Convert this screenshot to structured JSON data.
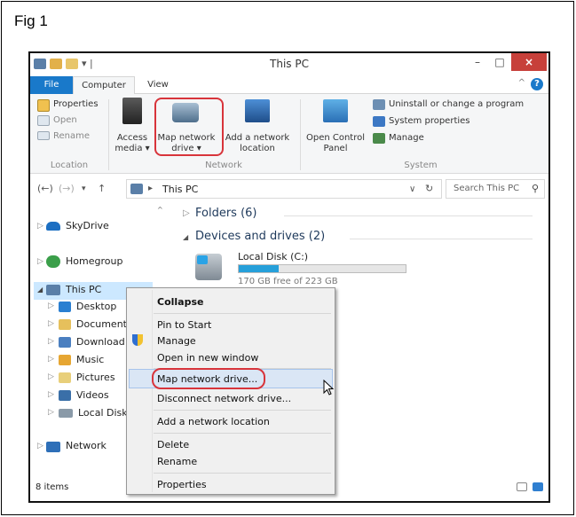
{
  "figure": {
    "label": "Fig 1"
  },
  "window": {
    "title": "This PC",
    "minimize_glyph": "–",
    "maximize_glyph": "□",
    "close_glyph": "×",
    "qat_glyph": "▾ |"
  },
  "ribbon_tabs": {
    "file": "File",
    "computer": "Computer",
    "view": "View",
    "collapse_glyph": "^",
    "help_glyph": "?"
  },
  "ribbon": {
    "properties": "Properties",
    "open": "Open",
    "rename": "Rename",
    "access_media_1": "Access",
    "access_media_2": "media ▾",
    "map_network_drive_1": "Map network",
    "map_network_drive_2": "drive ▾",
    "add_network_location_1": "Add a network",
    "add_network_location_2": "location",
    "open_control_panel_1": "Open Control",
    "open_control_panel_2": "Panel",
    "uninstall": "Uninstall or change a program",
    "system_properties": "System properties",
    "manage": "Manage",
    "group_location": "Location",
    "group_network": "Network",
    "group_system": "System"
  },
  "address": {
    "back_glyph": "(←)",
    "forward_glyph": "(→)",
    "history_glyph": "▾",
    "up_glyph": "↑",
    "path_sep": "▸",
    "path": "This PC",
    "dropdown_glyph": "∨",
    "refresh_glyph": "↻",
    "search_placeholder": "Search This PC",
    "search_glyph": "⚲"
  },
  "nav": {
    "skydrive": "SkyDrive",
    "homegroup": "Homegroup",
    "thispc": "This PC",
    "desktop": "Desktop",
    "documents": "Document",
    "downloads": "Download",
    "music": "Music",
    "pictures": "Pictures",
    "videos": "Videos",
    "localdisk": "Local Disk",
    "network": "Network",
    "expand_glyph": "▷",
    "expanded_glyph": "◢"
  },
  "content": {
    "folders": "Folders (6)",
    "devices": "Devices and drives (2)",
    "disk_name": "Local Disk (C:)",
    "disk_free": "170 GB free of 223 GB",
    "disk_used_fraction": 0.238,
    "collapsed_glyph": "▷",
    "expanded_glyph": "◢"
  },
  "status": {
    "items": "8 items"
  },
  "context_menu": {
    "collapse": "Collapse",
    "pin_to_start": "Pin to Start",
    "manage": "Manage",
    "open_new_window": "Open in new window",
    "map_network_drive": "Map network drive...",
    "disconnect_network_drive": "Disconnect network drive...",
    "add_network_location": "Add a network location",
    "delete": "Delete",
    "rename": "Rename",
    "properties": "Properties"
  },
  "colors": {
    "accent": "#1979ca",
    "highlight": "#d8343b",
    "selection": "#cce8ff",
    "progress": "#26a0da"
  }
}
